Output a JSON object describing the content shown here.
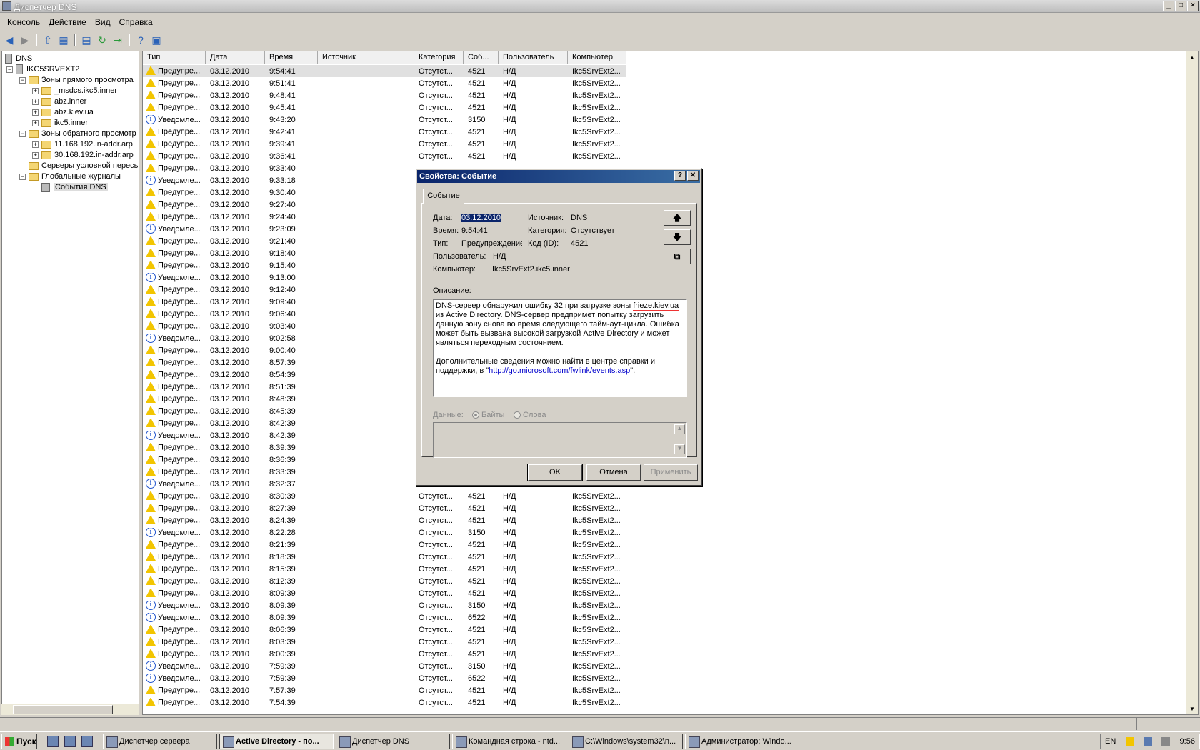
{
  "window": {
    "title": "Диспетчер DNS"
  },
  "menu": [
    "Консоль",
    "Действие",
    "Вид",
    "Справка"
  ],
  "tree": {
    "root": "DNS",
    "server": "IKC5SRVEXT2",
    "forward_zones": "Зоны прямого просмотра",
    "forward_items": [
      "_msdcs.ikc5.inner",
      "abz.inner",
      "abz.kiev.ua",
      "ikc5.inner"
    ],
    "reverse_zones": "Зоны обратного просмотр",
    "reverse_items": [
      "11.168.192.in-addr.arp",
      "30.168.192.in-addr.arp"
    ],
    "conditional": "Серверы условной пересь",
    "global_logs": "Глобальные журналы",
    "dns_events": "События DNS"
  },
  "columns": [
    "Тип",
    "Дата",
    "Время",
    "Источник",
    "Категория",
    "Соб...",
    "Пользователь",
    "Компьютер"
  ],
  "rows": [
    [
      "w",
      "Предупре...",
      "03.12.2010",
      "9:54:41",
      "",
      "Отсутст...",
      "4521",
      "Н/Д",
      "Ikc5SrvExt2..."
    ],
    [
      "w",
      "Предупре...",
      "03.12.2010",
      "9:51:41",
      "",
      "Отсутст...",
      "4521",
      "Н/Д",
      "Ikc5SrvExt2..."
    ],
    [
      "w",
      "Предупре...",
      "03.12.2010",
      "9:48:41",
      "",
      "Отсутст...",
      "4521",
      "Н/Д",
      "Ikc5SrvExt2..."
    ],
    [
      "w",
      "Предупре...",
      "03.12.2010",
      "9:45:41",
      "",
      "Отсутст...",
      "4521",
      "Н/Д",
      "Ikc5SrvExt2..."
    ],
    [
      "i",
      "Уведомле...",
      "03.12.2010",
      "9:43:20",
      "",
      "Отсутст...",
      "3150",
      "Н/Д",
      "Ikc5SrvExt2..."
    ],
    [
      "w",
      "Предупре...",
      "03.12.2010",
      "9:42:41",
      "",
      "Отсутст...",
      "4521",
      "Н/Д",
      "Ikc5SrvExt2..."
    ],
    [
      "w",
      "Предупре...",
      "03.12.2010",
      "9:39:41",
      "",
      "Отсутст...",
      "4521",
      "Н/Д",
      "Ikc5SrvExt2..."
    ],
    [
      "w",
      "Предупре...",
      "03.12.2010",
      "9:36:41",
      "",
      "Отсутст...",
      "4521",
      "Н/Д",
      "Ikc5SrvExt2..."
    ],
    [
      "w",
      "Предупре...",
      "03.12.2010",
      "9:33:40",
      "",
      "",
      "",
      "",
      ""
    ],
    [
      "i",
      "Уведомле...",
      "03.12.2010",
      "9:33:18",
      "",
      "",
      "",
      "",
      ""
    ],
    [
      "w",
      "Предупре...",
      "03.12.2010",
      "9:30:40",
      "",
      "",
      "",
      "",
      ""
    ],
    [
      "w",
      "Предупре...",
      "03.12.2010",
      "9:27:40",
      "",
      "",
      "",
      "",
      ""
    ],
    [
      "w",
      "Предупре...",
      "03.12.2010",
      "9:24:40",
      "",
      "",
      "",
      "",
      ""
    ],
    [
      "i",
      "Уведомле...",
      "03.12.2010",
      "9:23:09",
      "",
      "",
      "",
      "",
      ""
    ],
    [
      "w",
      "Предупре...",
      "03.12.2010",
      "9:21:40",
      "",
      "",
      "",
      "",
      ""
    ],
    [
      "w",
      "Предупре...",
      "03.12.2010",
      "9:18:40",
      "",
      "",
      "",
      "",
      ""
    ],
    [
      "w",
      "Предупре...",
      "03.12.2010",
      "9:15:40",
      "",
      "",
      "",
      "",
      ""
    ],
    [
      "i",
      "Уведомле...",
      "03.12.2010",
      "9:13:00",
      "",
      "",
      "",
      "",
      ""
    ],
    [
      "w",
      "Предупре...",
      "03.12.2010",
      "9:12:40",
      "",
      "",
      "",
      "",
      ""
    ],
    [
      "w",
      "Предупре...",
      "03.12.2010",
      "9:09:40",
      "",
      "",
      "",
      "",
      ""
    ],
    [
      "w",
      "Предупре...",
      "03.12.2010",
      "9:06:40",
      "",
      "",
      "",
      "",
      ""
    ],
    [
      "w",
      "Предупре...",
      "03.12.2010",
      "9:03:40",
      "",
      "",
      "",
      "",
      ""
    ],
    [
      "i",
      "Уведомле...",
      "03.12.2010",
      "9:02:58",
      "",
      "",
      "",
      "",
      ""
    ],
    [
      "w",
      "Предупре...",
      "03.12.2010",
      "9:00:40",
      "",
      "",
      "",
      "",
      ""
    ],
    [
      "w",
      "Предупре...",
      "03.12.2010",
      "8:57:39",
      "",
      "",
      "",
      "",
      ""
    ],
    [
      "w",
      "Предупре...",
      "03.12.2010",
      "8:54:39",
      "",
      "",
      "",
      "",
      ""
    ],
    [
      "w",
      "Предупре...",
      "03.12.2010",
      "8:51:39",
      "",
      "",
      "",
      "",
      ""
    ],
    [
      "w",
      "Предупре...",
      "03.12.2010",
      "8:48:39",
      "",
      "",
      "",
      "",
      ""
    ],
    [
      "w",
      "Предупре...",
      "03.12.2010",
      "8:45:39",
      "",
      "",
      "",
      "",
      ""
    ],
    [
      "w",
      "Предупре...",
      "03.12.2010",
      "8:42:39",
      "",
      "",
      "",
      "",
      ""
    ],
    [
      "i",
      "Уведомле...",
      "03.12.2010",
      "8:42:39",
      "",
      "",
      "",
      "",
      ""
    ],
    [
      "w",
      "Предупре...",
      "03.12.2010",
      "8:39:39",
      "",
      "",
      "",
      "",
      ""
    ],
    [
      "w",
      "Предупре...",
      "03.12.2010",
      "8:36:39",
      "",
      "",
      "",
      "",
      ""
    ],
    [
      "w",
      "Предупре...",
      "03.12.2010",
      "8:33:39",
      "",
      "",
      "",
      "",
      ""
    ],
    [
      "i",
      "Уведомле...",
      "03.12.2010",
      "8:32:37",
      "",
      "",
      "",
      "",
      ""
    ],
    [
      "w",
      "Предупре...",
      "03.12.2010",
      "8:30:39",
      "",
      "Отсутст...",
      "4521",
      "Н/Д",
      "Ikc5SrvExt2..."
    ],
    [
      "w",
      "Предупре...",
      "03.12.2010",
      "8:27:39",
      "",
      "Отсутст...",
      "4521",
      "Н/Д",
      "Ikc5SrvExt2..."
    ],
    [
      "w",
      "Предупре...",
      "03.12.2010",
      "8:24:39",
      "",
      "Отсутст...",
      "4521",
      "Н/Д",
      "Ikc5SrvExt2..."
    ],
    [
      "i",
      "Уведомле...",
      "03.12.2010",
      "8:22:28",
      "",
      "Отсутст...",
      "3150",
      "Н/Д",
      "Ikc5SrvExt2..."
    ],
    [
      "w",
      "Предупре...",
      "03.12.2010",
      "8:21:39",
      "",
      "Отсутст...",
      "4521",
      "Н/Д",
      "Ikc5SrvExt2..."
    ],
    [
      "w",
      "Предупре...",
      "03.12.2010",
      "8:18:39",
      "",
      "Отсутст...",
      "4521",
      "Н/Д",
      "Ikc5SrvExt2..."
    ],
    [
      "w",
      "Предупре...",
      "03.12.2010",
      "8:15:39",
      "",
      "Отсутст...",
      "4521",
      "Н/Д",
      "Ikc5SrvExt2..."
    ],
    [
      "w",
      "Предупре...",
      "03.12.2010",
      "8:12:39",
      "",
      "Отсутст...",
      "4521",
      "Н/Д",
      "Ikc5SrvExt2..."
    ],
    [
      "w",
      "Предупре...",
      "03.12.2010",
      "8:09:39",
      "",
      "Отсутст...",
      "4521",
      "Н/Д",
      "Ikc5SrvExt2..."
    ],
    [
      "i",
      "Уведомле...",
      "03.12.2010",
      "8:09:39",
      "",
      "Отсутст...",
      "3150",
      "Н/Д",
      "Ikc5SrvExt2..."
    ],
    [
      "i",
      "Уведомле...",
      "03.12.2010",
      "8:09:39",
      "",
      "Отсутст...",
      "6522",
      "Н/Д",
      "Ikc5SrvExt2..."
    ],
    [
      "w",
      "Предупре...",
      "03.12.2010",
      "8:06:39",
      "",
      "Отсутст...",
      "4521",
      "Н/Д",
      "Ikc5SrvExt2..."
    ],
    [
      "w",
      "Предупре...",
      "03.12.2010",
      "8:03:39",
      "",
      "Отсутст...",
      "4521",
      "Н/Д",
      "Ikc5SrvExt2..."
    ],
    [
      "w",
      "Предупре...",
      "03.12.2010",
      "8:00:39",
      "",
      "Отсутст...",
      "4521",
      "Н/Д",
      "Ikc5SrvExt2..."
    ],
    [
      "i",
      "Уведомле...",
      "03.12.2010",
      "7:59:39",
      "",
      "Отсутст...",
      "3150",
      "Н/Д",
      "Ikc5SrvExt2..."
    ],
    [
      "i",
      "Уведомле...",
      "03.12.2010",
      "7:59:39",
      "",
      "Отсутст...",
      "6522",
      "Н/Д",
      "Ikc5SrvExt2..."
    ],
    [
      "w",
      "Предупре...",
      "03.12.2010",
      "7:57:39",
      "",
      "Отсутст...",
      "4521",
      "Н/Д",
      "Ikc5SrvExt2..."
    ],
    [
      "w",
      "Предупре...",
      "03.12.2010",
      "7:54:39",
      "",
      "Отсутст...",
      "4521",
      "Н/Д",
      "Ikc5SrvExt2..."
    ]
  ],
  "dialog": {
    "title": "Свойства: Событие",
    "help": "?",
    "close": "✕",
    "tab": "Событие",
    "date_label": "Дата:",
    "date": "03.12.2010",
    "source_label": "Источник:",
    "source": "DNS",
    "time_label": "Время:",
    "time": "9:54:41",
    "category_label": "Категория:",
    "category": "Отсутствует",
    "type_label": "Тип:",
    "type": "Предупреждение",
    "code_label": "Код (ID):",
    "code": "4521",
    "user_label": "Пользователь:",
    "user": "Н/Д",
    "computer_label": "Компьютер:",
    "computer": "Ikc5SrvExt2.ikc5.inner",
    "desc_label": "Описание:",
    "desc_p1a": "DNS-сервер обнаружил ошибку 32 при загрузке зоны ",
    "desc_zone": "frieze.kiev.ua",
    "desc_p1b": " из Active Directory. DNS-сервер предпримет попытку загрузить данную зону снова во время следующего тайм-аут-цикла. Ошибка может быть вызвана высокой загрузкой Active Directory и может являться переходным состоянием.",
    "desc_p2a": "Дополнительные сведения можно найти в центре справки и поддержки, в \"",
    "desc_link": "http://go.microsoft.com/fwlink/events.asp",
    "desc_p2b": "\".",
    "data_label": "Данные:",
    "bytes": "Байты",
    "words": "Слова",
    "ok": "OK",
    "cancel": "Отмена",
    "apply": "Применить"
  },
  "taskbar": {
    "start": "Пуск",
    "tasks": [
      "Диспетчер сервера",
      "Active Directory - по...",
      "Диспетчер DNS",
      "Командная строка - ntd...",
      "C:\\Windows\\system32\\n...",
      "Администратор: Windo..."
    ],
    "lang": "EN",
    "clock": "9:56"
  }
}
